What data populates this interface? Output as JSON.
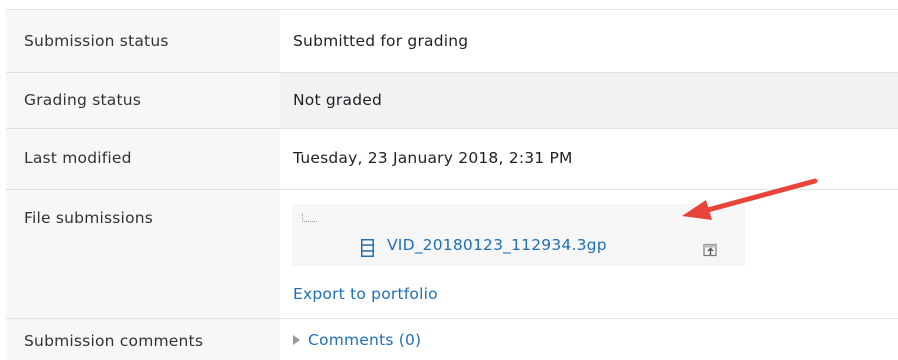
{
  "rows": {
    "submission_status": {
      "label": "Submission status",
      "value": "Submitted for grading"
    },
    "grading_status": {
      "label": "Grading status",
      "value": "Not graded"
    },
    "last_modified": {
      "label": "Last modified",
      "value": "Tuesday, 23 January 2018, 2:31 PM"
    },
    "file_submissions": {
      "label": "File submissions",
      "file_name": "VID_20180123_112934.3gp",
      "file_icon": "video-file-icon",
      "export_link": "Export to portfolio",
      "export_icon": "portfolio-export-icon"
    },
    "submission_comments": {
      "label": "Submission comments",
      "link": "Comments (0)"
    }
  },
  "annotation": {
    "arrow_color": "#e8443a"
  },
  "colors": {
    "link": "#1f6fb2",
    "shaded_cell": "#f2f2f2"
  }
}
